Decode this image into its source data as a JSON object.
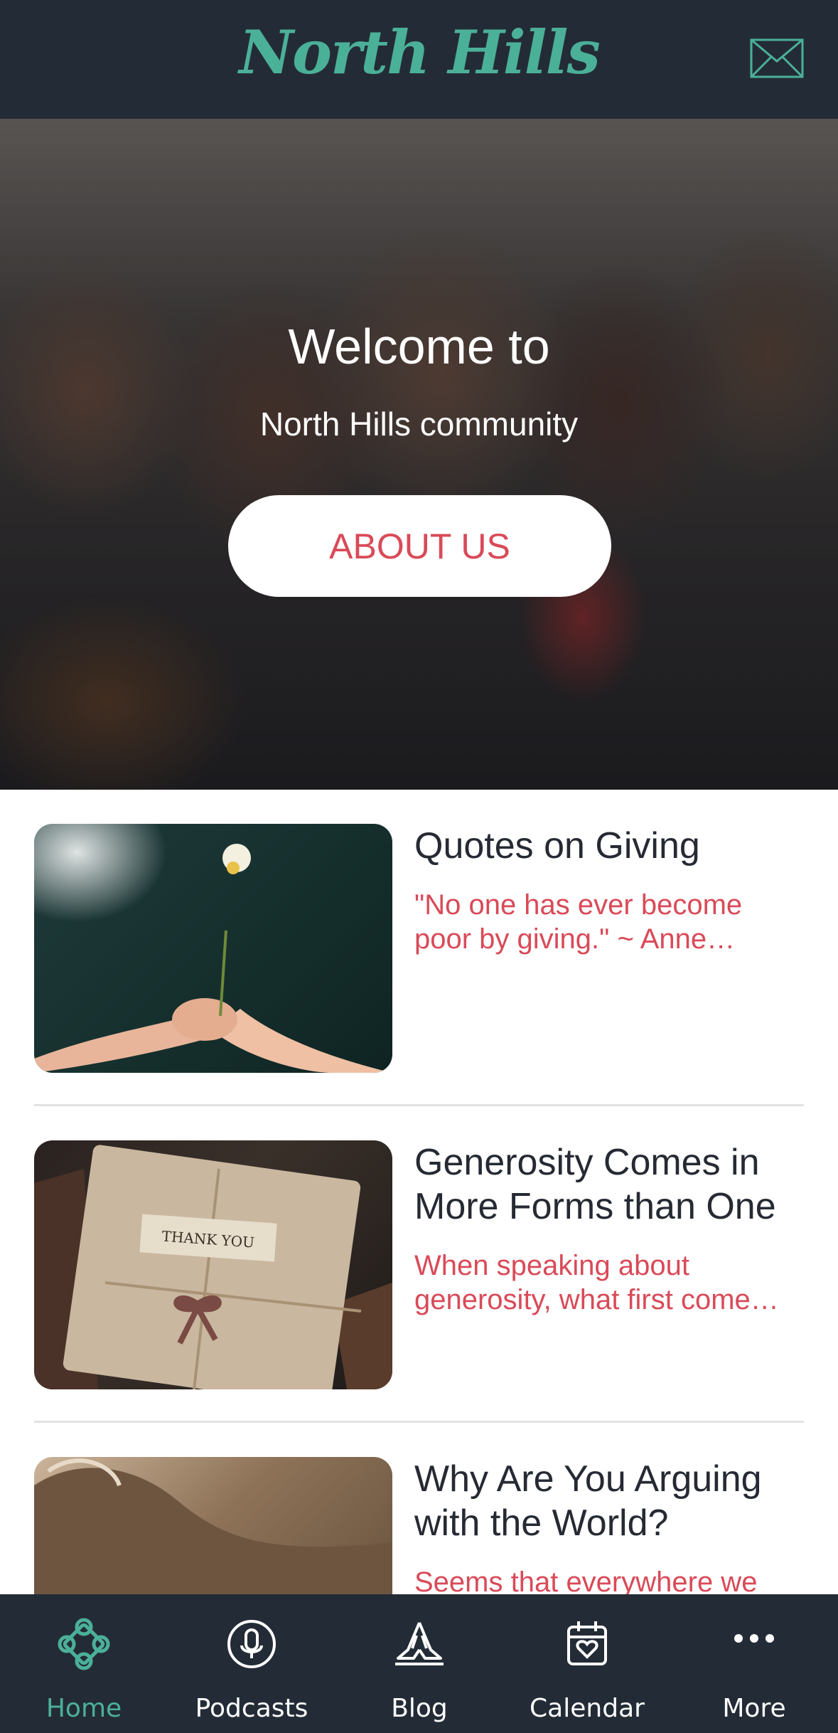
{
  "header": {
    "logo_text": "North Hills",
    "mail_icon": "mail-icon"
  },
  "hero": {
    "title": "Welcome to",
    "subtitle": "North Hills community",
    "button_label": "ABOUT US"
  },
  "feed": {
    "items": [
      {
        "title": "Quotes on Giving",
        "excerpt": "\"No one has ever become poor by giving.\" ~ Anne…"
      },
      {
        "title": "Generosity Comes in More Forms than One",
        "excerpt": "When speaking about generosity, what first come…"
      },
      {
        "title": "Why Are You Arguing with the World?",
        "excerpt": "Seems that everywhere we"
      }
    ]
  },
  "thumbs": {
    "thank_you_tag": "THANK YOU"
  },
  "nav": {
    "items": [
      {
        "label": "Home",
        "icon": "celtic-knot-icon",
        "active": true
      },
      {
        "label": "Podcasts",
        "icon": "microphone-icon",
        "active": false
      },
      {
        "label": "Blog",
        "icon": "praying-hands-icon",
        "active": false
      },
      {
        "label": "Calendar",
        "icon": "calendar-heart-icon",
        "active": false
      },
      {
        "label": "More",
        "icon": "more-dots-icon",
        "active": false
      }
    ]
  },
  "colors": {
    "header_bg": "#232c36",
    "brand_teal": "#4bb098",
    "accent_red": "#d94a58",
    "title_text": "#252a33"
  }
}
